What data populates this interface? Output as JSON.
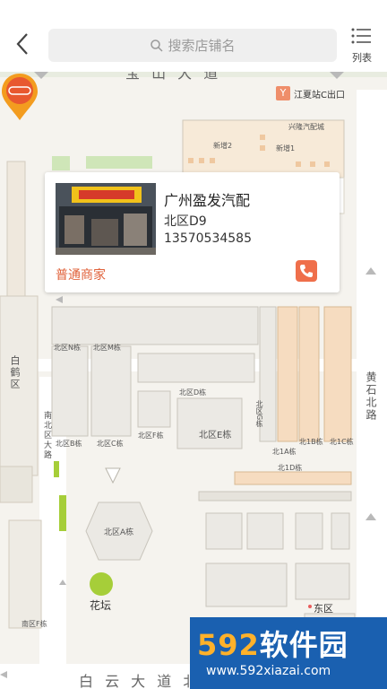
{
  "header": {
    "search_placeholder": "搜索店铺名",
    "list_label": "列表"
  },
  "map": {
    "road_top_partial": "宝 山 大 道",
    "exit": "江夏站C出口",
    "road_bottom": "白 云 大 道 北",
    "road_left": "南北区大路",
    "road_right": "黄石北路",
    "west_area": "白鹤区",
    "flower_bed": "花坛",
    "east_area": "东区",
    "labels": {
      "xingtang": "兴隆汽配城",
      "xin2": "新增2",
      "xin1": "新增1",
      "bei_n": "北区N栋",
      "bei_m": "北区M栋",
      "bei_d": "北区D栋",
      "bei_b": "北区B栋",
      "bei_c": "北区C栋",
      "bei_f": "北区F栋",
      "bei_e": "北区E栋",
      "bei_g": "北区G栋",
      "bei_1b": "北1B栋",
      "bei_1c": "北1C栋",
      "bei_1a": "北1A栋",
      "bei_1d": "北1D栋",
      "bei_a": "北区A栋",
      "nan_f": "南区F栋"
    }
  },
  "popup": {
    "shop_name": "广州盈发汽配",
    "area": "北区D9",
    "phone": "13570534585",
    "merchant_type": "普通商家"
  },
  "watermark": {
    "brand_digits": "592",
    "brand_text": "软件园",
    "url": "www.592xiazai.com"
  },
  "colors": {
    "accent": "#ef6f4b",
    "merchant_type": "#e0613a",
    "pin": "#f39c1f",
    "watermark_bg": "#1a60b0"
  }
}
